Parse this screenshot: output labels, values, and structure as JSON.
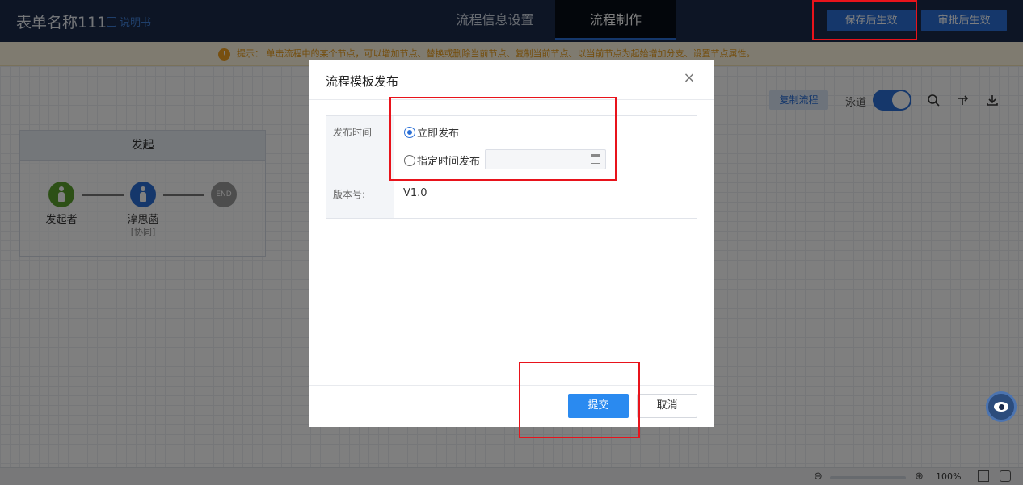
{
  "header": {
    "app_title": "表单名称111",
    "manual_label": "说明书",
    "tabs": [
      {
        "label": "流程信息设置"
      },
      {
        "label": "流程制作"
      }
    ],
    "save_label": "保存后生效",
    "approve_label": "审批后生效"
  },
  "hint": {
    "text": "提示：  单击流程中的某个节点，可以增加节点、替换或删除当前节点、复制当前节点、以当前节点为起始增加分支、设置节点属性。"
  },
  "toolbar": {
    "copy_label": "复制流程",
    "lane_label": "泳道",
    "lane_toggle_on": true
  },
  "flow": {
    "lane_title": "发起",
    "nodes": [
      {
        "label": "发起者",
        "tag": ""
      },
      {
        "label": "淳思菡",
        "tag": "[协同]"
      },
      {
        "label": "END",
        "tag": ""
      }
    ]
  },
  "zoom": {
    "level": "100%"
  },
  "modal": {
    "title": "流程模板发布",
    "publish_time_label": "发布时间",
    "option_now": "立即发布",
    "option_scheduled": "指定时间发布",
    "selected_option": "立即发布",
    "scheduled_value": "",
    "version_label": "版本号:",
    "version_value": "V1.0",
    "submit_label": "提交",
    "cancel_label": "取消"
  },
  "colors": {
    "topbar": "#1b2a4a",
    "accent": "#2a6fd6",
    "highlight": "#e8131b"
  }
}
